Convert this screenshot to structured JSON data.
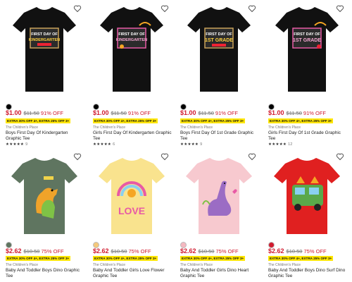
{
  "products": [
    {
      "price": "$1.00",
      "original": "$11.50",
      "discount": "91% OFF",
      "promo": "EXTRA 30% OFF 4+, EXTRA 25% OFF 3+",
      "brand": "The Children's Place",
      "name": "Boys First Day Of Kindergarten Graphic Tee",
      "stars": "★★★★★",
      "reviews": "9",
      "shirt_color": "#111111",
      "swatch_color": "#000000",
      "graphic": "FIRST DAY OF KINDERGARTEN"
    },
    {
      "price": "$1.00",
      "original": "$11.50",
      "discount": "91% OFF",
      "promo": "EXTRA 30% OFF 4+, EXTRA 25% OFF 3+",
      "brand": "The Children's Place",
      "name": "Girls First Day Of Kindergarten Graphic Tee",
      "stars": "★★★★★",
      "reviews": "6",
      "shirt_color": "#111111",
      "swatch_color": "#000000",
      "graphic": "FIRST DAY OF KINDERGARTEN"
    },
    {
      "price": "$1.00",
      "original": "$11.50",
      "discount": "91% OFF",
      "promo": "EXTRA 30% OFF 4+, EXTRA 25% OFF 3+",
      "brand": "The Children's Place",
      "name": "Boys First Day Of 1st Grade Graphic Tee",
      "stars": "★★★★★",
      "reviews": "9",
      "shirt_color": "#111111",
      "swatch_color": "#000000",
      "graphic": "FIRST DAY OF 1ST GRADE"
    },
    {
      "price": "$1.00",
      "original": "$11.50",
      "discount": "91% OFF",
      "promo": "EXTRA 30% OFF 4+, EXTRA 25% OFF 3+",
      "brand": "The Children's Place",
      "name": "Girls First Day Of 1st Grade Graphic Tee",
      "stars": "★★★★★",
      "reviews": "12",
      "shirt_color": "#111111",
      "swatch_color": "#000000",
      "graphic": "FIRST DAY OF 1ST GRADE"
    },
    {
      "price": "$2.62",
      "original": "$10.50",
      "discount": "75% OFF",
      "promo": "EXTRA 30% OFF 4+, EXTRA 25% OFF 3+",
      "brand": "The Children's Place",
      "name": "Baby And Toddler Boys Dino Graphic Tee",
      "stars": "",
      "reviews": "",
      "shirt_color": "#5f7560",
      "swatch_color": "#5f7560",
      "graphic": "dino"
    },
    {
      "price": "$2.62",
      "original": "$10.50",
      "discount": "75% OFF",
      "promo": "EXTRA 30% OFF 4+, EXTRA 25% OFF 3+",
      "brand": "The Children's Place",
      "name": "Baby And Toddler Girls Love Flower Graphic Tee",
      "stars": "",
      "reviews": "",
      "shirt_color": "#f9e38e",
      "swatch_color": "#f5c97a",
      "graphic": "LOVE"
    },
    {
      "price": "$2.62",
      "original": "$10.50",
      "discount": "75% OFF",
      "promo": "EXTRA 30% OFF 4+, EXTRA 25% OFF 3+",
      "brand": "The Children's Place",
      "name": "Baby And Toddler Girls Dino Heart Graphic Tee",
      "stars": "",
      "reviews": "",
      "shirt_color": "#f7c9cf",
      "swatch_color": "#f4b8c0",
      "graphic": "dino-heart"
    },
    {
      "price": "$2.62",
      "original": "$10.50",
      "discount": "75% OFF",
      "promo": "EXTRA 30% OFF 4+, EXTRA 25% OFF 3+",
      "brand": "The Children's Place",
      "name": "Baby And Toddler Boys Dino Surf Dino Graphic Tee",
      "stars": "",
      "reviews": "",
      "shirt_color": "#e02020",
      "swatch_color": "#d11b2f",
      "graphic": "surf"
    }
  ]
}
